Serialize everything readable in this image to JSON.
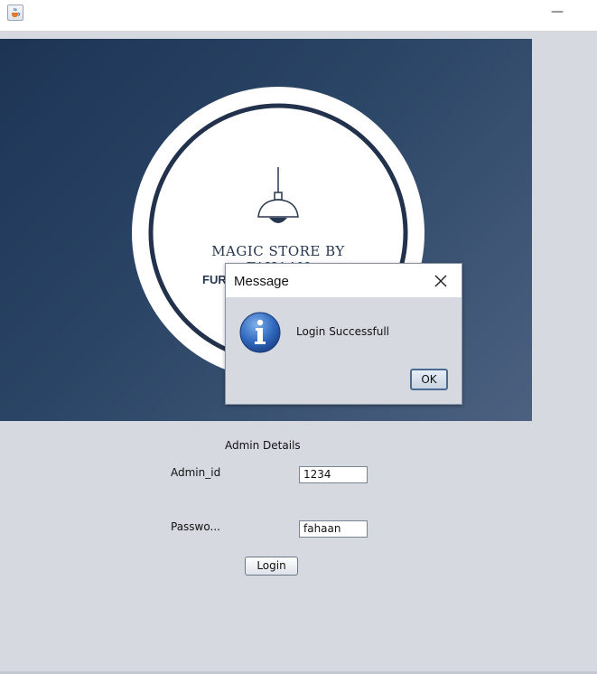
{
  "window": {
    "icon": "java-cup-icon",
    "minimize_glyph": "—"
  },
  "banner": {
    "title": "MAGIC STORE BY FAHAAN",
    "subtitle": "FUR",
    "icon": "pendant-lamp-icon",
    "gradient_from": "#1d3455",
    "gradient_to": "#4c6180"
  },
  "form": {
    "heading": "Admin Details",
    "admin_id_label": "Admin_id",
    "admin_id_value": "1234",
    "password_label": "Passwo...",
    "password_value": "fahaan",
    "login_button": "Login"
  },
  "dialog": {
    "title": "Message",
    "close_icon": "close-icon",
    "message": "Login Successfull",
    "info_icon": "information-icon",
    "ok_button": "OK"
  }
}
